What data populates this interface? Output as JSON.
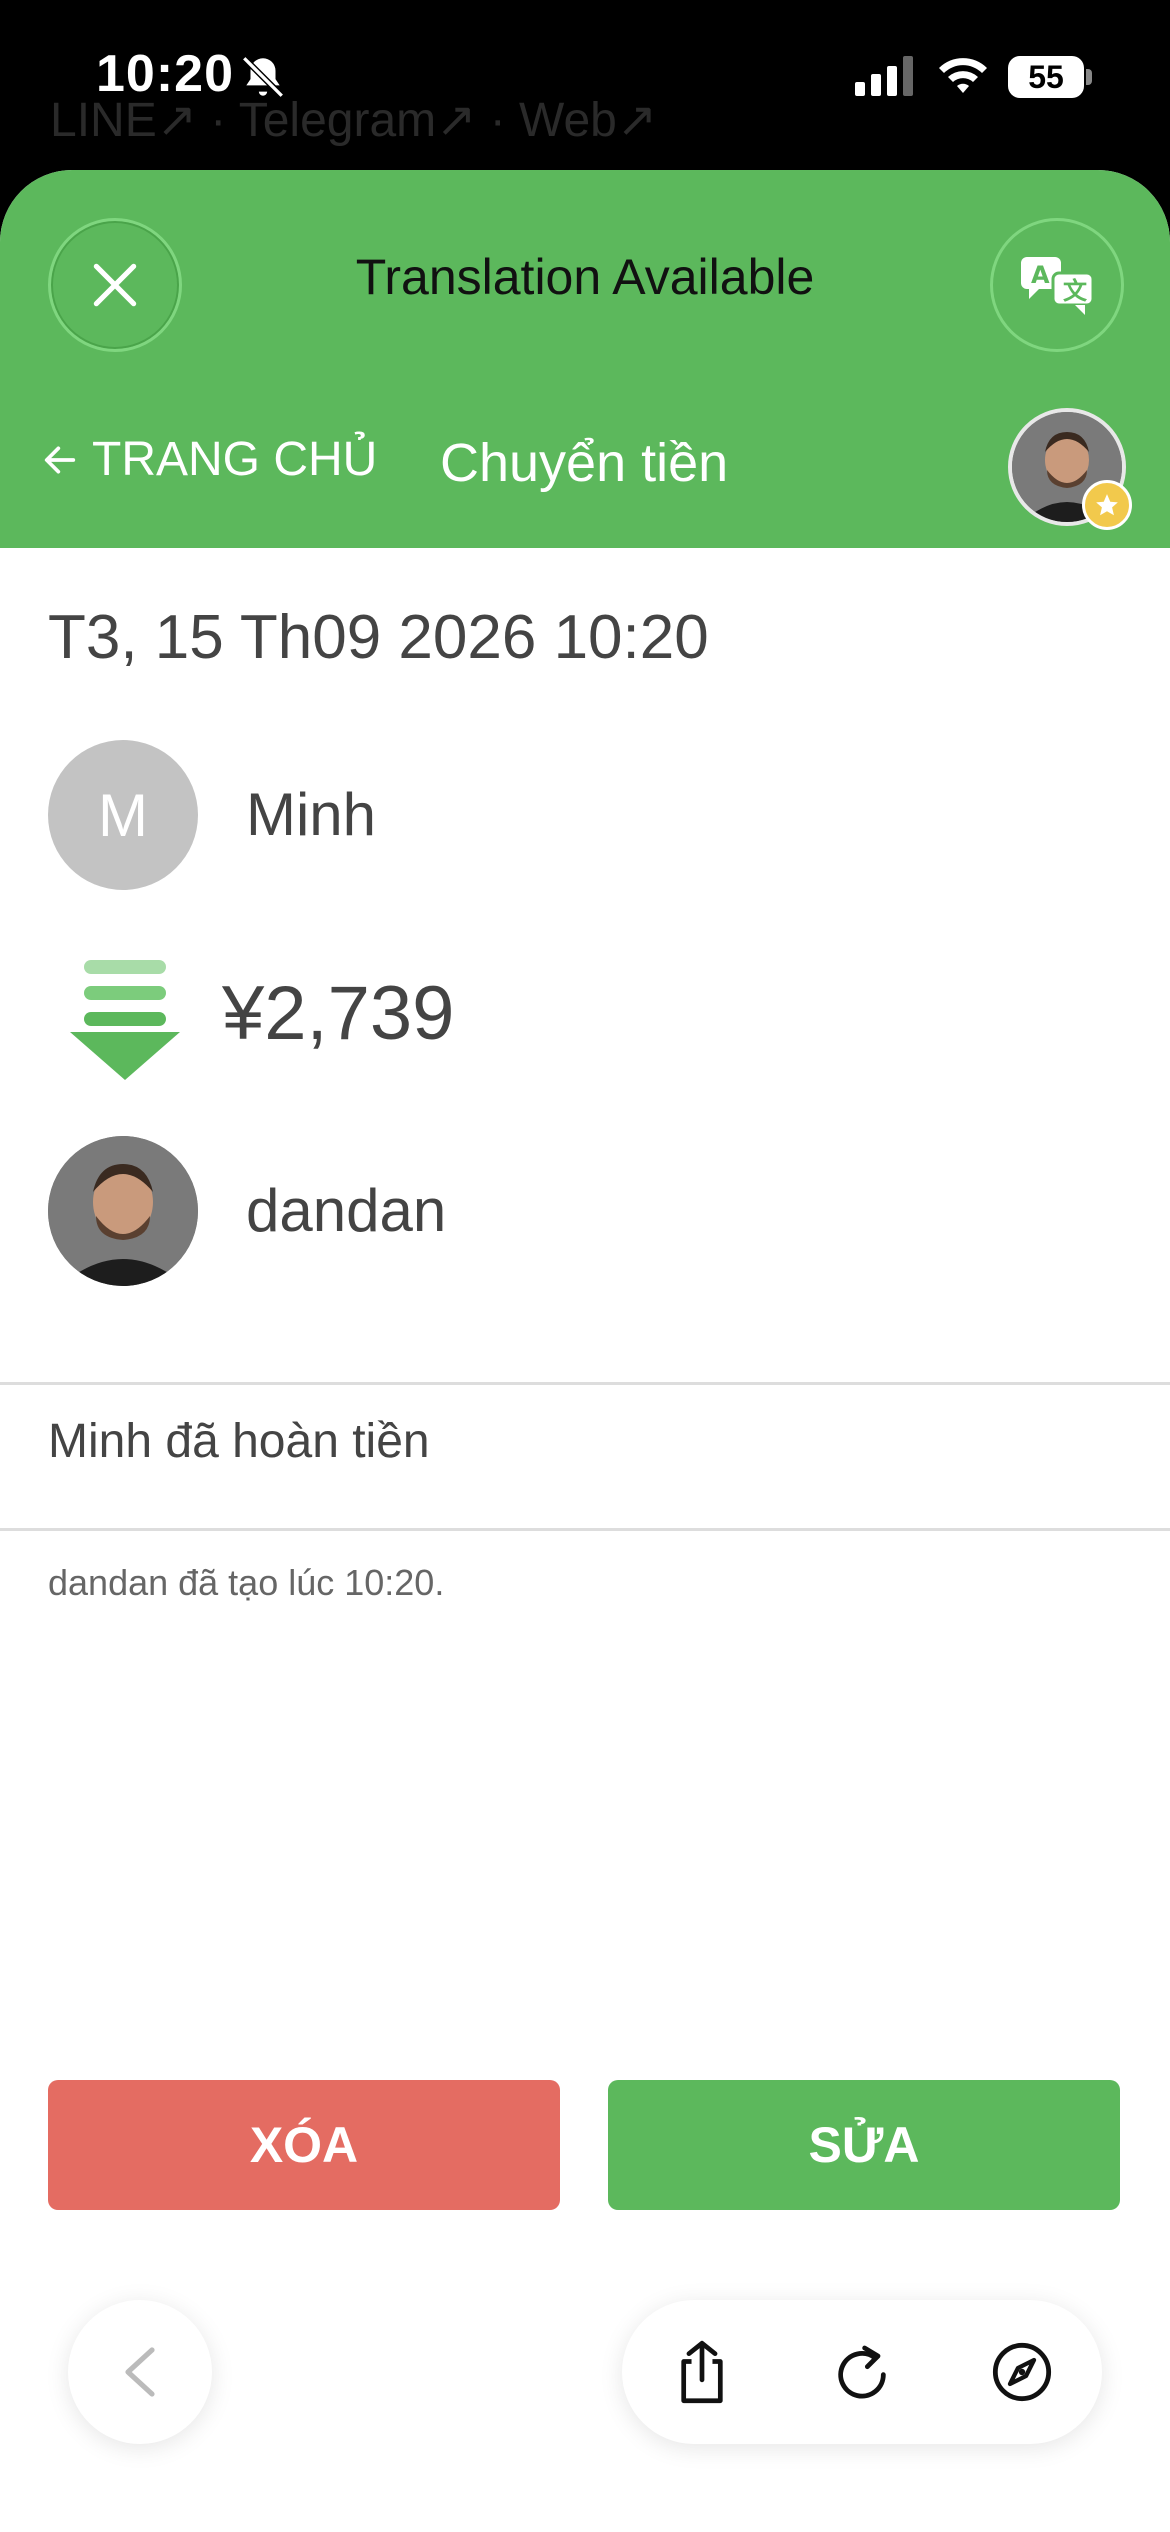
{
  "status_bar": {
    "time": "10:20",
    "battery": "55"
  },
  "background": {
    "links": "LINE↗ · Telegram↗ · Web↗"
  },
  "header": {
    "title": "Translation Available",
    "back_label": "TRANG CHỦ",
    "page_title": "Chuyển tiền"
  },
  "transfer": {
    "datetime": "T3, 15 Th09 2026 10:20",
    "from": {
      "initial": "M",
      "name": "Minh"
    },
    "amount": "¥2,739",
    "to": {
      "name": "dandan"
    },
    "note": "Minh đã hoàn tiền",
    "meta": "dandan đã tạo lúc 10:20."
  },
  "actions": {
    "delete_label": "XÓA",
    "edit_label": "SỬA"
  },
  "colors": {
    "green": "#5cb85c",
    "red": "#e46c62",
    "grey_avatar": "#c3c3c3"
  },
  "icons": [
    "bell-slash-icon",
    "signal-icon",
    "wifi-icon",
    "battery-icon",
    "close-icon",
    "translate-icon",
    "arrow-left-icon",
    "star-badge-icon",
    "transfer-down-icon",
    "chevron-left-icon",
    "share-icon",
    "reload-icon",
    "compass-icon"
  ]
}
